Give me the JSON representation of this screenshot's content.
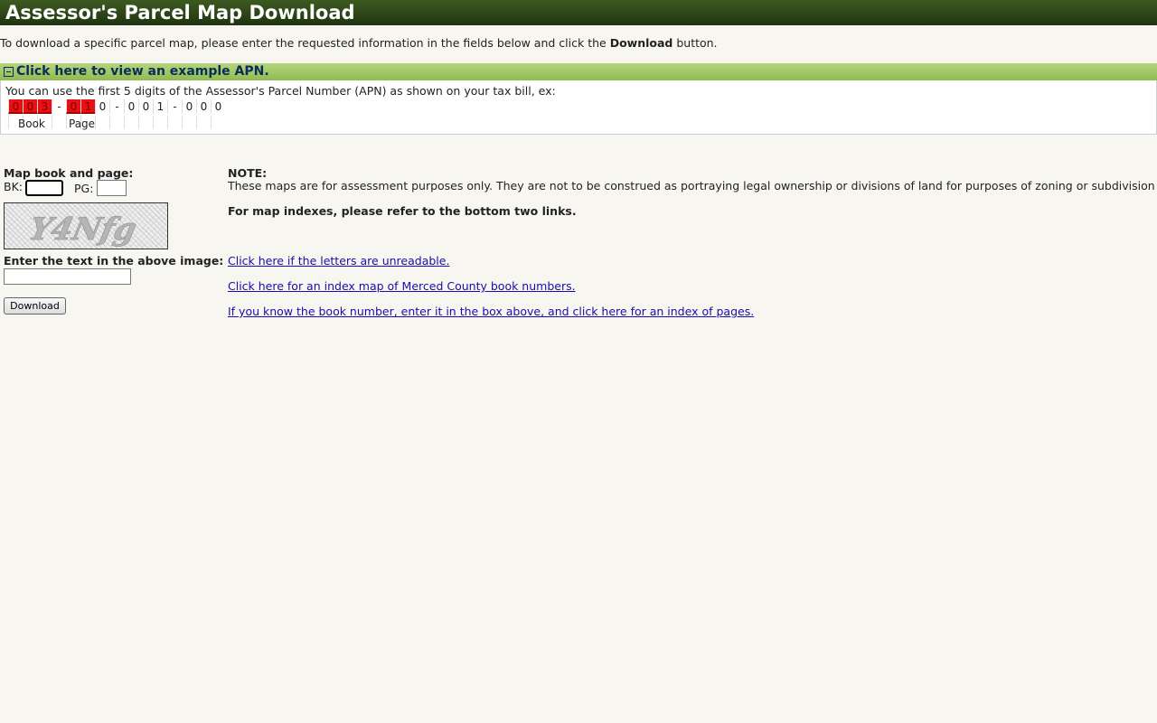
{
  "header": {
    "title": "Assessor's Parcel Map Download"
  },
  "intro": {
    "text_before": "To download a specific parcel map, please enter the requested information in the fields below and click the ",
    "bold": "Download",
    "text_after": " button."
  },
  "apn_panel": {
    "toggle_label": "Click here to view an example APN.",
    "description": "You can use the first 5 digits of the Assessor's Parcel Number (APN) as shown on your tax bill, ex:",
    "digits": [
      "0",
      "0",
      "3",
      "-",
      "0",
      "1",
      "0",
      "-",
      "0",
      "0",
      "1",
      "-",
      "0",
      "0",
      "0"
    ],
    "highlighted": [
      0,
      1,
      2,
      4,
      5
    ],
    "book_label": "Book",
    "page_label": "Page"
  },
  "form": {
    "map_label": "Map book and page:",
    "bk_label": "BK:",
    "pg_label": "PG:",
    "bk_value": "",
    "pg_value": "",
    "captcha_text": "Y4Nfg",
    "captcha_label": "Enter the text in the above image:",
    "captcha_value": "",
    "download_label": "Download"
  },
  "note": {
    "title": "NOTE:",
    "text": "These maps are for assessment purposes only. They are not to be construed as portraying legal ownership or divisions of land for purposes of zoning or subdivision law.",
    "index_note": "For map indexes, please refer to the bottom two links."
  },
  "links": {
    "unreadable": "Click here if the letters are unreadable.",
    "index_map": "Click here for an index map of Merced County book numbers.",
    "index_pages": "If you know the book number, enter it in the box above, and click here for an index of pages."
  }
}
